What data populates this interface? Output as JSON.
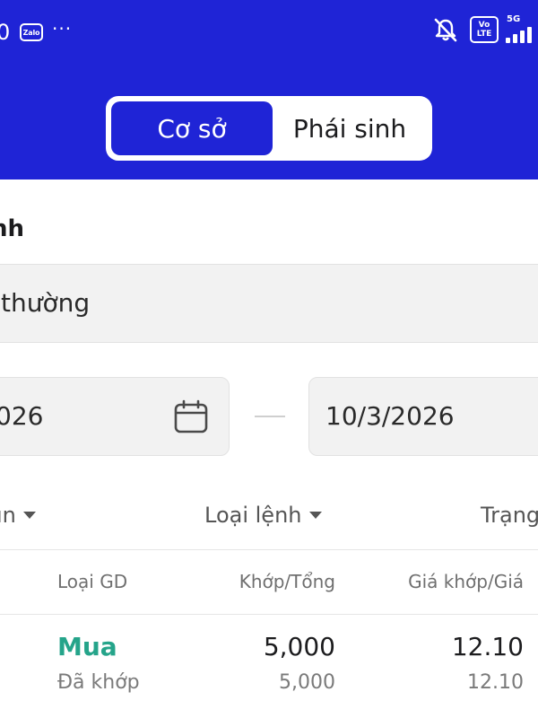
{
  "status_bar": {
    "clock_fragment": "0",
    "zalo_label": "Zalo",
    "more": "···",
    "volte_top": "Vo",
    "volte_bottom": "LTE",
    "network": "5G"
  },
  "tabs": {
    "active": "Cơ sở",
    "inactive": "Phái sinh"
  },
  "form": {
    "section_label": "nh",
    "order_type_value": "thường",
    "date_from": "026",
    "date_to": "10/3/2026"
  },
  "filters": {
    "left": "ın",
    "order_type": "Loại lệnh",
    "status": "Trạng"
  },
  "table": {
    "headers": {
      "side": "Loại GD",
      "qty": "Khớp/Tổng",
      "price": "Giá khớp/Giá"
    },
    "rows": [
      {
        "side": "Mua",
        "status": "Đã khớp",
        "matched_qty": "5,000",
        "total_qty": "5,000",
        "matched_price": "12.10",
        "order_price": "12.10"
      }
    ]
  },
  "colors": {
    "brand": "#1f24d6",
    "buy": "#25a48a"
  }
}
